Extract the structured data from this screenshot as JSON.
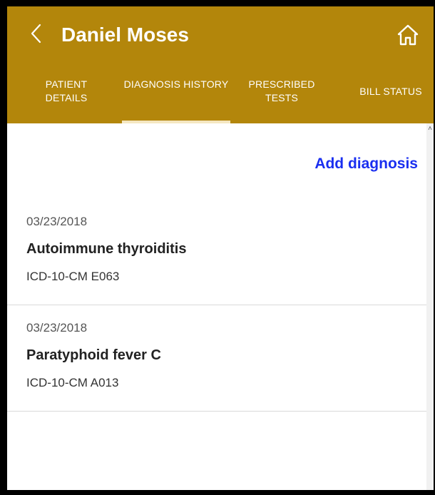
{
  "header": {
    "back_icon": "chevron-left-icon",
    "title": "Daniel Moses",
    "home_icon": "home-icon",
    "background_color": "#b3860b"
  },
  "tabs": [
    {
      "label": "PATIENT DETAILS",
      "active": false
    },
    {
      "label": "DIAGNOSIS HISTORY",
      "active": true
    },
    {
      "label": "PRESCRIBED TESTS",
      "active": false
    },
    {
      "label": "BILL STATUS",
      "active": false
    }
  ],
  "actions": {
    "add_diagnosis": "Add diagnosis",
    "link_color": "#1a2ff0"
  },
  "diagnoses": [
    {
      "date": "03/23/2018",
      "name": "Autoimmune thyroiditis",
      "code": "ICD-10-CM E063"
    },
    {
      "date": "03/23/2018",
      "name": "Paratyphoid fever C",
      "code": "ICD-10-CM A013"
    }
  ]
}
